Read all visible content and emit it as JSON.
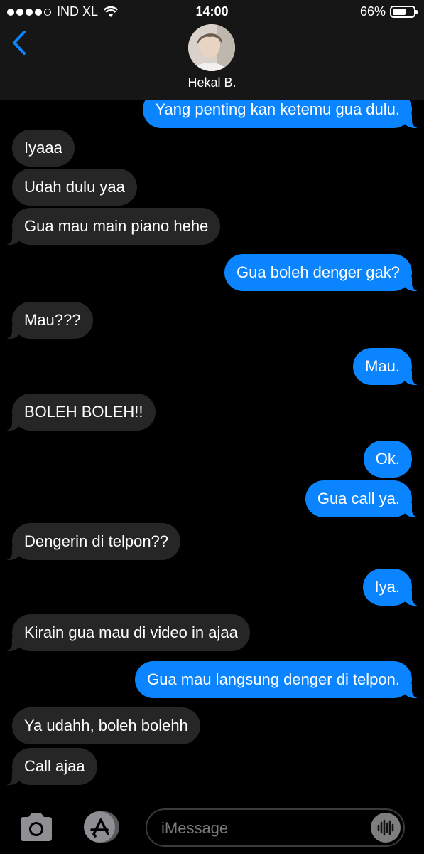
{
  "status_bar": {
    "carrier": "IND XL",
    "time": "14:00",
    "battery": "66%",
    "battery_level": 0.66
  },
  "header": {
    "contact_name": "Hekal B.",
    "back_icon": "chevron-left-icon"
  },
  "messages": [
    {
      "dir": "out",
      "text": "Yang penting kan ketemu gua dulu.",
      "partial": true
    },
    {
      "dir": "in",
      "text": "Iyaaa"
    },
    {
      "dir": "in",
      "text": "Udah dulu yaa"
    },
    {
      "dir": "in",
      "text": "Gua mau main piano hehe"
    },
    {
      "dir": "out",
      "text": "Gua boleh denger gak?"
    },
    {
      "dir": "in",
      "text": "Mau???"
    },
    {
      "dir": "out",
      "text": "Mau."
    },
    {
      "dir": "in",
      "text": "BOLEH BOLEH!!"
    },
    {
      "dir": "out",
      "text": "Ok."
    },
    {
      "dir": "out",
      "text": "Gua call ya."
    },
    {
      "dir": "in",
      "text": "Dengerin di telpon??"
    },
    {
      "dir": "out",
      "text": "Iya."
    },
    {
      "dir": "in",
      "text": "Kirain gua mau di video in ajaa"
    },
    {
      "dir": "out",
      "text": "Gua mau langsung denger di telpon."
    },
    {
      "dir": "in",
      "text": "Ya udahh, boleh bolehh"
    },
    {
      "dir": "in",
      "text": "Call ajaa"
    }
  ],
  "input_bar": {
    "placeholder": "iMessage",
    "camera_icon": "camera-icon",
    "appstore_icon": "app-store-icon",
    "audio_icon": "audio-waveform-icon"
  },
  "colors": {
    "outgoing_bubble": "#0a84ff",
    "incoming_bubble": "#262626",
    "background": "#000000"
  }
}
